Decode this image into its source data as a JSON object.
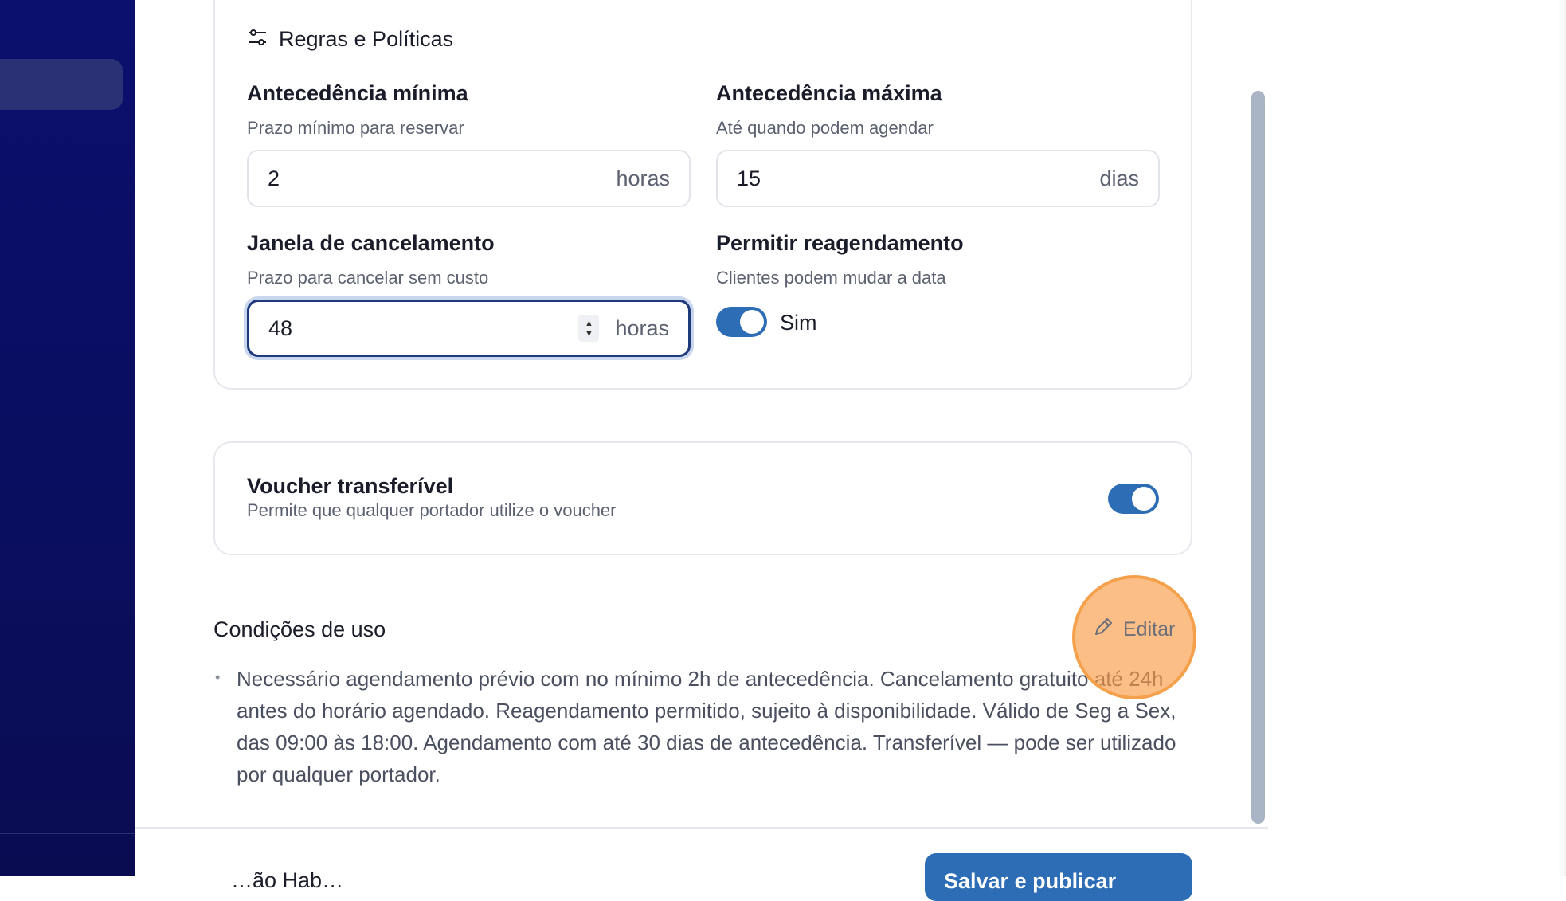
{
  "rules": {
    "title": "Regras e Políticas",
    "min_advance": {
      "label": "Antecedência mínima",
      "help": "Prazo mínimo para reservar",
      "value": "2",
      "unit": "horas"
    },
    "max_advance": {
      "label": "Antecedência máxima",
      "help": "Até quando podem agendar",
      "value": "15",
      "unit": "dias"
    },
    "cancel_window": {
      "label": "Janela de cancelamento",
      "help": "Prazo para cancelar sem custo",
      "value": "48",
      "unit": "horas"
    },
    "reschedule": {
      "label": "Permitir reagendamento",
      "help": "Clientes podem mudar a data",
      "toggle_label": "Sim",
      "enabled": true
    }
  },
  "voucher": {
    "title": "Voucher transferível",
    "description": "Permite que qualquer portador utilize o voucher",
    "enabled": true
  },
  "conditions": {
    "title": "Condições de uso",
    "edit_label": "Editar",
    "bullet": "•",
    "text": "Necessário agendamento prévio com no mínimo 2h de antecedência. Cancelamento gratuito até 24h antes do horário agendado. Reagendamento permitido, sujeito à disponibilidade. Válido de Seg a Sex, das 09:00 às 18:00. Agendamento com até 30 dias de antecedência. Transferível — pode ser utilizado por qualquer portador."
  },
  "footer": {
    "left_text": "…ão Hab…",
    "primary_button": "Salvar e publicar"
  },
  "colors": {
    "accent": "#2d6db5",
    "sidebar": "#0b0f6e",
    "highlight": "#f5a04b"
  }
}
